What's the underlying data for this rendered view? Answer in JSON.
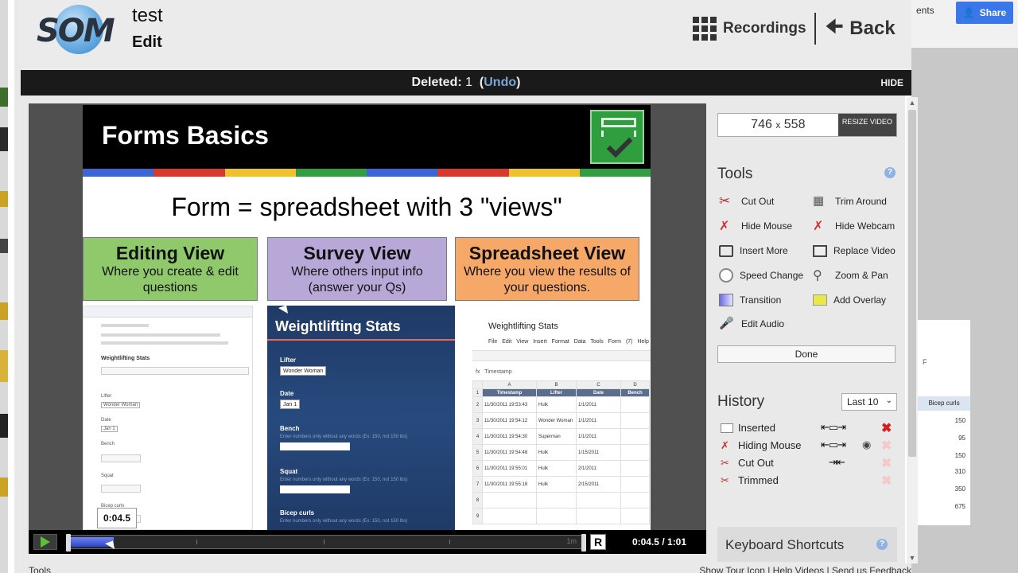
{
  "background": {
    "comments_partial": "ents",
    "share_label": "Share",
    "sheet": {
      "col_letter": "F",
      "header": "Bicep curls",
      "values": [
        "150",
        "95",
        "150",
        "310",
        "350",
        "675"
      ]
    }
  },
  "header": {
    "logo_text": "SOM",
    "title": "test",
    "mode": "Edit",
    "recordings_label": "Recordings",
    "back_label": "Back"
  },
  "notice": {
    "deleted_label": "Deleted:",
    "deleted_count": "1",
    "undo_label": "Undo",
    "hide_label": "HIDE"
  },
  "slide": {
    "title": "Forms Basics",
    "subtitle": "Form = spreadsheet with 3 \"views\"",
    "boxes": [
      {
        "heading": "Editing View",
        "text": "Where you create & edit questions",
        "color": "#8fc96b"
      },
      {
        "heading": "Survey View",
        "text": "Where others input info (answer your Qs)",
        "color": "#b7a8d8"
      },
      {
        "heading": "Spreadsheet View",
        "text": "Where you view the results of your questions.",
        "color": "#f5a868"
      }
    ],
    "band_colors": [
      "#3a66d6",
      "#d63a2f",
      "#f2c12a",
      "#2f9e44",
      "#3a66d6",
      "#d63a2f",
      "#f2c12a",
      "#2f9e44"
    ],
    "editing_shot": {
      "title": "Weightlifting Stats",
      "labels": [
        "Lifter",
        "Date",
        "Bench",
        "Squat",
        "Bicep curls"
      ],
      "selects": [
        "Wonder Woman",
        "Jan 1"
      ]
    },
    "survey_shot": {
      "title": "Weightlifting Stats",
      "fields": [
        {
          "label": "Lifter",
          "select": "Wonder Woman"
        },
        {
          "label": "Date",
          "select": "Jan 1"
        },
        {
          "label": "Bench",
          "hint": "Enter numbers only without any words (Ex: 150, not 150 lbs)"
        },
        {
          "label": "Squat",
          "hint": "Enter numbers only without any words (Ex: 150, not 150 lbs)"
        },
        {
          "label": "Bicep curls",
          "hint": "Enter numbers only without any words (Ex: 150, not 150 lbs)"
        }
      ]
    },
    "sheet_shot": {
      "title": "Weightlifting Stats",
      "menu": "File Edit View Insert Format Data Tools Form (7) Help",
      "fx_label": "fx",
      "fx_value": "Timestamp",
      "col_letters": [
        "",
        "A",
        "B",
        "C",
        "D"
      ],
      "headers": [
        "Timestamp",
        "Lifter",
        "Date",
        "Bench"
      ],
      "rows": [
        [
          "2",
          "11/30/2011 19:53:43",
          "Hulk",
          "1/1/2011",
          ""
        ],
        [
          "3",
          "11/30/2011 19:54:12",
          "Wonder Woman",
          "1/1/2011",
          ""
        ],
        [
          "4",
          "11/30/2011 19:54:30",
          "Superman",
          "1/1/2011",
          ""
        ],
        [
          "5",
          "11/30/2011 19:54:48",
          "Hulk",
          "1/15/2011",
          ""
        ],
        [
          "6",
          "11/30/2011 19:55:01",
          "Hulk",
          "2/1/2011",
          ""
        ],
        [
          "7",
          "11/30/2011 19:55:18",
          "Hulk",
          "2/15/2011",
          ""
        ],
        [
          "8",
          "",
          "",
          "",
          ""
        ],
        [
          "9",
          "",
          "",
          "",
          ""
        ]
      ]
    }
  },
  "player": {
    "bubble_time": "0:04.5",
    "progress_fraction": 0.086,
    "end_marker": "1m",
    "r_label": "R",
    "current_time": "0:04.5",
    "separator": "/",
    "total_time": "1:01"
  },
  "panel": {
    "width": "746",
    "x_label": "x",
    "height": "558",
    "resize_label": "RESIZE VIDEO",
    "tools_title": "Tools",
    "tools": [
      {
        "label": "Cut Out",
        "icon": "scissors-icon"
      },
      {
        "label": "Trim Around",
        "icon": "trim-icon"
      },
      {
        "label": "Hide Mouse",
        "icon": "hide-mouse-icon"
      },
      {
        "label": "Hide Webcam",
        "icon": "hide-webcam-icon"
      },
      {
        "label": "Insert More",
        "icon": "monitor-icon"
      },
      {
        "label": "Replace Video",
        "icon": "replace-video-icon"
      },
      {
        "label": "Speed Change",
        "icon": "clock-icon"
      },
      {
        "label": "Zoom & Pan",
        "icon": "magnifier-icon"
      },
      {
        "label": "Transition",
        "icon": "transition-icon"
      },
      {
        "label": "Add Overlay",
        "icon": "overlay-icon"
      },
      {
        "label": "Edit Audio",
        "icon": "microphone-icon"
      }
    ],
    "done_label": "Done",
    "history_title": "History",
    "history_filter": "Last 10",
    "history": [
      {
        "label": "Inserted",
        "range": "⇤▭⇥",
        "deletable": true
      },
      {
        "label": "Hiding Mouse",
        "range": "⇤▭⇥",
        "eye": "◉",
        "deletable": false
      },
      {
        "label": "Cut Out",
        "range": "⇥⇤",
        "deletable": false
      },
      {
        "label": "Trimmed",
        "range": "",
        "deletable": false
      }
    ],
    "shortcuts_title": "Keyboard Shortcuts"
  },
  "footer": {
    "left": "Tools",
    "right": "Show Tour Icon  |  Help Videos  |  Send us Feedback"
  }
}
